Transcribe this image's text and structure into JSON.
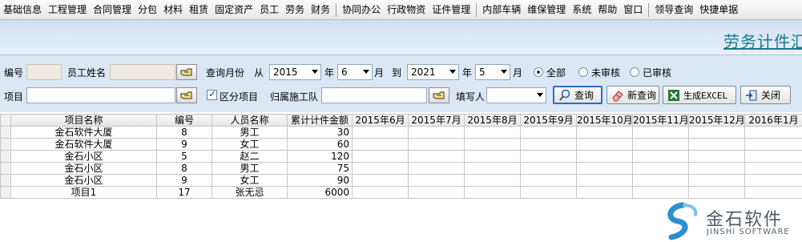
{
  "menu": [
    "基础信息",
    "工程管理",
    "合同管理",
    "分包",
    "材料",
    "租赁",
    "固定资产",
    "员工",
    "劳务",
    "财务",
    "协同办公",
    "行政物资",
    "证件管理",
    "内部车辆",
    "维保管理",
    "系统",
    "帮助",
    "窗口",
    "领导查询",
    "快捷单据"
  ],
  "page_title": "劳务计件汇总",
  "filters": {
    "code_label": "编号",
    "employee_label": "员工姓名",
    "query_month_label": "查询月份",
    "from_label": "从",
    "from_year": "2015",
    "year_label": "年",
    "from_month": "6",
    "month_label": "月",
    "to_label": "到",
    "to_year": "2021",
    "to_month": "5",
    "radio_all": "全部",
    "radio_unreviewed": "未审核",
    "radio_reviewed": "已审核",
    "project_label": "项目",
    "split_project_label": "区分项目",
    "team_label": "归属施工队",
    "filler_label": "填写人"
  },
  "buttons": {
    "query": "查询",
    "new_query": "新查询",
    "excel": "生成EXCEL",
    "close": "关闭"
  },
  "table": {
    "columns": [
      "项目名称",
      "编号",
      "人员名称",
      "累计计件金额",
      "2015年6月",
      "2015年7月",
      "2015年8月",
      "2015年9月",
      "2015年10月",
      "2015年11月",
      "2015年12月",
      "2016年1月"
    ],
    "rows": [
      [
        "金石软件大厦",
        "8",
        "男工",
        "30"
      ],
      [
        "金石软件大厦",
        "9",
        "女工",
        "60"
      ],
      [
        "金石小区",
        "5",
        "赵二",
        "120"
      ],
      [
        "金石小区",
        "8",
        "男工",
        "75"
      ],
      [
        "金石小区",
        "9",
        "女工",
        "90"
      ],
      [
        "项目1",
        "17",
        "张无忌",
        "6000"
      ]
    ]
  },
  "logo": {
    "name": "金石软件",
    "sub": "JINSHI SOFTWARE"
  }
}
